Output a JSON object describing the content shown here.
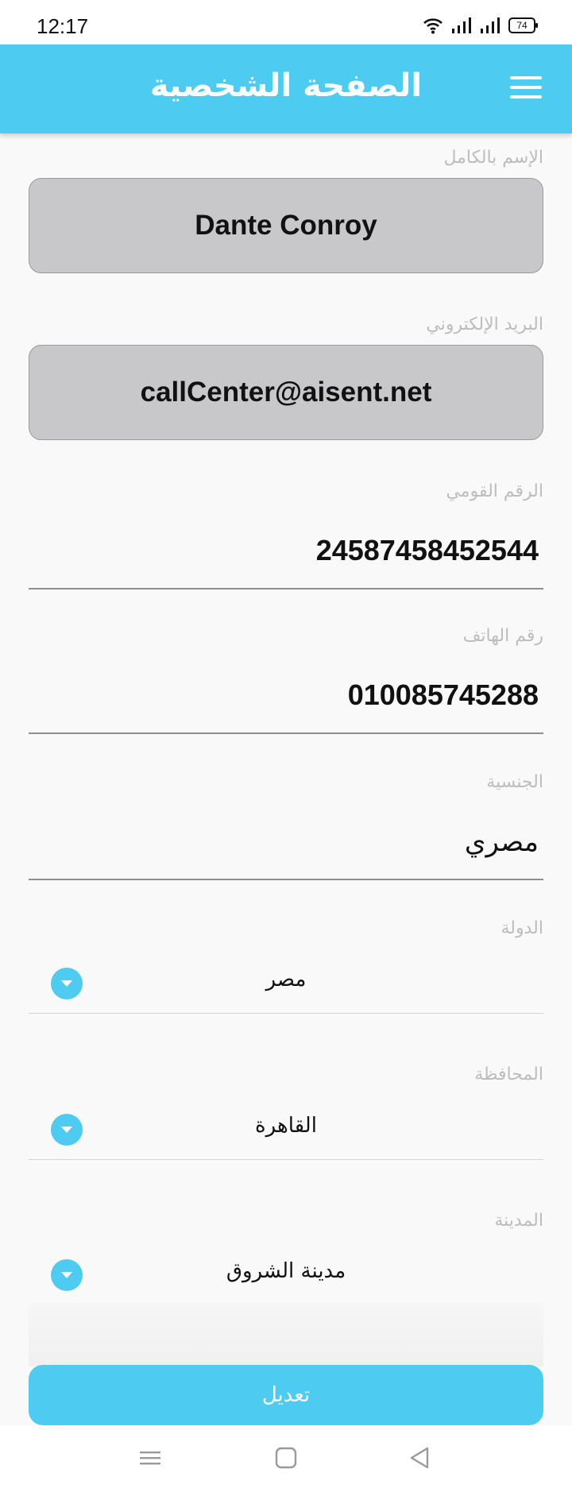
{
  "status_bar": {
    "time": "12:17",
    "battery": "74"
  },
  "header": {
    "title": "الصفحة الشخصية",
    "menu_icon": "hamburger-menu-icon"
  },
  "fields": {
    "full_name": {
      "label": "الإسم بالكامل",
      "value": "Dante Conroy"
    },
    "email": {
      "label": "البريد الإلكتروني",
      "value": "callCenter@aisent.net"
    },
    "national_id": {
      "label": "الرقم القومي",
      "value": "24587458452544"
    },
    "phone": {
      "label": "رقم الهاتف",
      "value": "010085745288"
    },
    "nationality": {
      "label": "الجنسية",
      "value": "مصري"
    },
    "country": {
      "label": "الدولة",
      "value": "مصر"
    },
    "governorate": {
      "label": "المحافظة",
      "value": "القاهرة"
    },
    "city": {
      "label": "المدينة",
      "value": "مدينة الشروق"
    }
  },
  "edit_button": {
    "label": "تعديل"
  },
  "colors": {
    "accent": "#4ecbf1",
    "box_fill": "#c8c8ca",
    "label": "#bdbdbd"
  }
}
